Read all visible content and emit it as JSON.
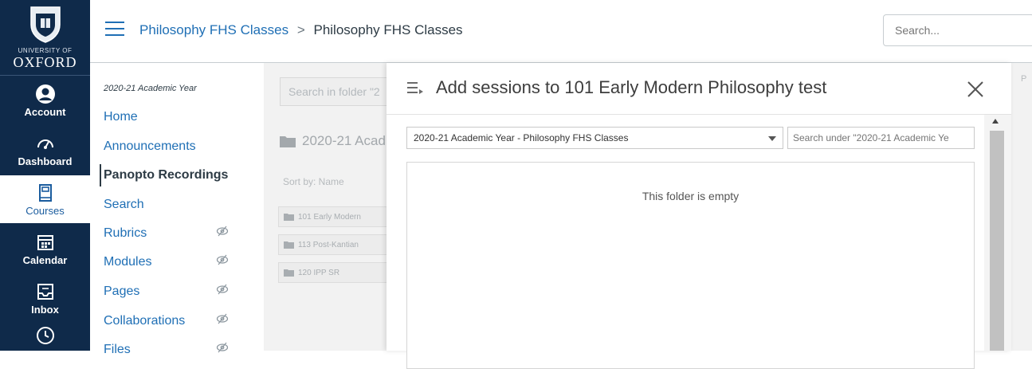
{
  "global_nav": {
    "logo": {
      "line1": "UNIVERSITY OF",
      "line2": "OXFORD"
    },
    "items": [
      {
        "label": "Account",
        "icon": "account-icon"
      },
      {
        "label": "Dashboard",
        "icon": "dashboard-icon"
      },
      {
        "label": "Courses",
        "icon": "courses-icon",
        "active": true
      },
      {
        "label": "Calendar",
        "icon": "calendar-icon"
      },
      {
        "label": "Inbox",
        "icon": "inbox-icon"
      },
      {
        "label": "",
        "icon": "history-icon"
      }
    ]
  },
  "header": {
    "breadcrumb": [
      "Philosophy FHS Classes",
      "Philosophy FHS Classes"
    ],
    "breadcrumb_separator": ">",
    "search_placeholder": "Search..."
  },
  "course_nav": {
    "term": "2020-21 Academic Year",
    "items": [
      {
        "label": "Home"
      },
      {
        "label": "Announcements"
      },
      {
        "label": "Panopto Recordings",
        "active": true
      },
      {
        "label": "Search"
      },
      {
        "label": "Rubrics",
        "hidden": true
      },
      {
        "label": "Modules",
        "hidden": true
      },
      {
        "label": "Pages",
        "hidden": true
      },
      {
        "label": "Collaborations",
        "hidden": true
      },
      {
        "label": "Files",
        "hidden": true
      }
    ]
  },
  "background": {
    "search_placeholder": "Search in folder \"2",
    "folder_title": "2020-21 Acad",
    "sort_label": "Sort by:  Name",
    "rows": [
      "101 Early Modern",
      "113 Post-Kantian",
      "120 IPP SR"
    ],
    "right_label": "P"
  },
  "modal": {
    "title": "Add sessions to 101 Early Modern Philosophy test",
    "folder_select_value": "2020-21 Academic Year - Philosophy FHS Classes",
    "subfolder_search_placeholder": "Search under \"2020-21 Academic Ye",
    "empty_message": "This folder is empty"
  },
  "colors": {
    "nav_bg": "#0f2a4a",
    "link": "#1f6fb5",
    "text": "#2d3b45"
  }
}
